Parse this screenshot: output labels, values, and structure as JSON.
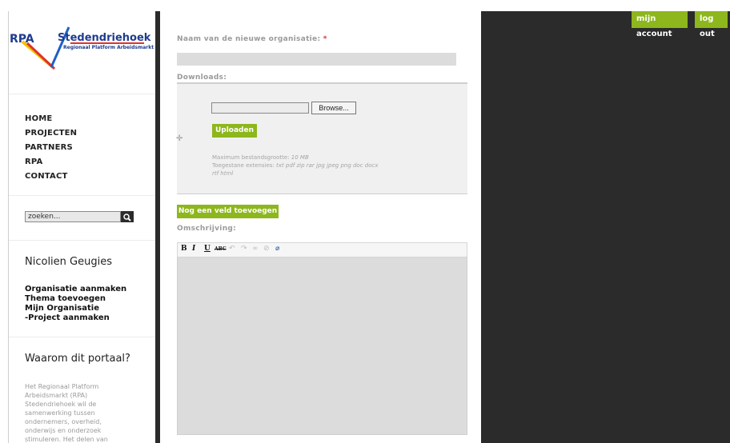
{
  "header": {
    "account_label": "mijn account",
    "logout_label": "log out"
  },
  "logo": {
    "rpa": "RPA",
    "name": "Stedendriehoek",
    "subtitle": "Regionaal Platform Arbeidsmarkt"
  },
  "nav": {
    "items": [
      "HOME",
      "PROJECTEN",
      "PARTNERS",
      "RPA",
      "CONTACT"
    ]
  },
  "search": {
    "placeholder": "zoeken..."
  },
  "user": {
    "name": "Nicolien Geugies",
    "links": [
      "Organisatie aanmaken",
      "Thema toevoegen",
      "Mijn Organisatie",
      "-Project aanmaken"
    ]
  },
  "about": {
    "title": "Waarom dit portaal?",
    "text": "Het Regionaal Platform Arbeidsmarkt (RPA) Stedendriehoek wil de samenwerking tussen ondernemers, overheid, onderwijs en onderzoek stimuleren. Het delen van kennis en ervaring is"
  },
  "form": {
    "name_label": "Naam van de nieuwe organisatie:",
    "required_mark": "*",
    "downloads_label": "Downloads:",
    "browse_label": "Browse...",
    "upload_label": "Uploaden",
    "max_size_label": "Maximum bestandsgrootte:",
    "max_size_value": "10 MB",
    "extensions_label": "Toegestane extensies:",
    "extensions_value": "txt pdf zip rar jpg jpeg png doc docx rtf html",
    "add_field_label": "Nog een veld toevoegen",
    "description_label": "Omschrijving:"
  },
  "editor": {
    "bold": "B",
    "italic": "I",
    "underline": "U",
    "strike": "ABC"
  },
  "colors": {
    "accent": "#8db71c",
    "dark": "#2b2b2b",
    "logo_blue": "#1f3c8f"
  }
}
